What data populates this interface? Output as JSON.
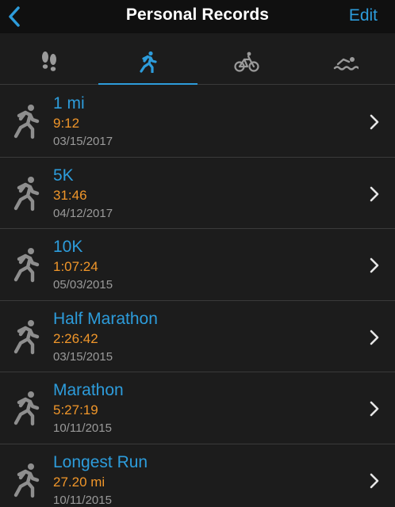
{
  "header": {
    "title": "Personal Records",
    "edit_label": "Edit"
  },
  "tabs": [
    {
      "icon": "footsteps-icon",
      "selected": false
    },
    {
      "icon": "running-icon",
      "selected": true
    },
    {
      "icon": "cycling-icon",
      "selected": false
    },
    {
      "icon": "swimming-icon",
      "selected": false
    }
  ],
  "records": [
    {
      "title": "1 mi",
      "value": "9:12",
      "date": "03/15/2017"
    },
    {
      "title": "5K",
      "value": "31:46",
      "date": "04/12/2017"
    },
    {
      "title": "10K",
      "value": "1:07:24",
      "date": "05/03/2015"
    },
    {
      "title": "Half Marathon",
      "value": "2:26:42",
      "date": "03/15/2015"
    },
    {
      "title": "Marathon",
      "value": "5:27:19",
      "date": "10/11/2015"
    },
    {
      "title": "Longest Run",
      "value": "27.20 mi",
      "date": "10/11/2015"
    }
  ],
  "colors": {
    "accent": "#2d9cdb",
    "value": "#f0962a",
    "date": "#9a9a9a",
    "background": "#1c1c1c"
  }
}
